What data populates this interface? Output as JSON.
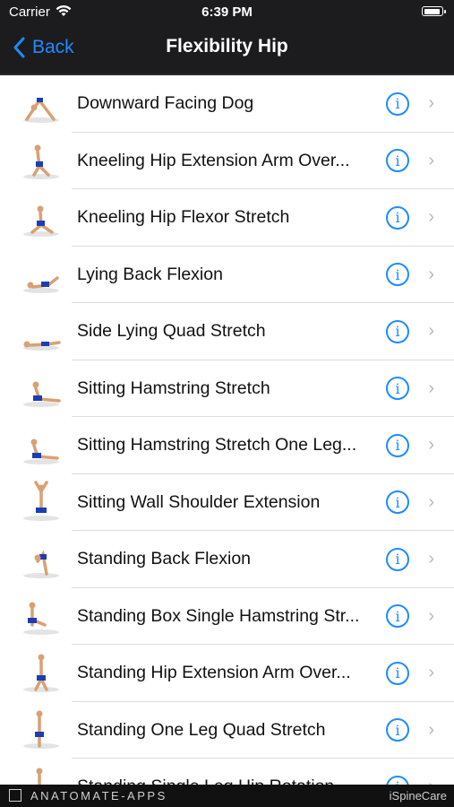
{
  "status_bar": {
    "carrier": "Carrier",
    "time": "6:39 PM",
    "icons": [
      "wifi-icon",
      "battery-icon"
    ]
  },
  "nav": {
    "back_label": "Back",
    "title": "Flexibility Hip",
    "accent_color": "#1e8bff",
    "background": "#1c1c1e"
  },
  "exercises": [
    {
      "label": "Downward Facing Dog",
      "thumbnail": "downward-dog-figure"
    },
    {
      "label": "Kneeling Hip Extension Arm Over...",
      "thumbnail": "kneeling-arm-over-figure"
    },
    {
      "label": "Kneeling Hip Flexor Stretch",
      "thumbnail": "kneeling-flexor-figure"
    },
    {
      "label": "Lying Back Flexion",
      "thumbnail": "lying-back-figure"
    },
    {
      "label": "Side Lying Quad Stretch",
      "thumbnail": "side-lying-figure"
    },
    {
      "label": "Sitting Hamstring Stretch",
      "thumbnail": "sitting-hamstring-figure"
    },
    {
      "label": "Sitting Hamstring Stretch One Leg...",
      "thumbnail": "sitting-one-leg-figure"
    },
    {
      "label": "Sitting Wall Shoulder Extension",
      "thumbnail": "sitting-wall-figure"
    },
    {
      "label": "Standing Back Flexion",
      "thumbnail": "standing-back-figure"
    },
    {
      "label": "Standing Box Single Hamstring Str...",
      "thumbnail": "standing-box-figure"
    },
    {
      "label": "Standing Hip Extension Arm Over...",
      "thumbnail": "standing-arm-over-figure"
    },
    {
      "label": "Standing One Leg Quad Stretch",
      "thumbnail": "standing-quad-figure"
    },
    {
      "label": "Standing Single Leg Hip Rotation",
      "thumbnail": "standing-rotation-figure"
    }
  ],
  "row_icons": {
    "info": "info-icon",
    "disclosure": "chevron-right-icon"
  },
  "footer": {
    "brand": "ANATOMATE-APPS",
    "app_name": "iSpineCare"
  }
}
